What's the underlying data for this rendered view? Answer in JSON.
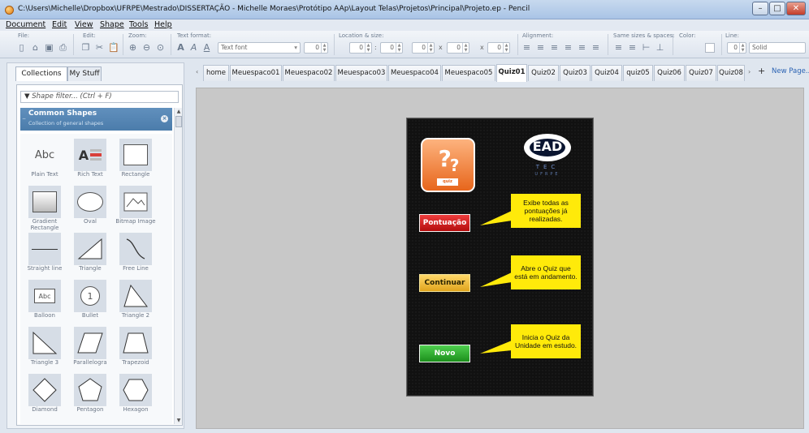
{
  "window": {
    "title": "C:\\Users\\Michelle\\Dropbox\\UFRPE\\Mestrado\\DISSERTAÇÃO - Michelle Moraes\\Protótipo AAp\\Layout Telas\\Projetos\\Principal\\Projeto.ep - Pencil",
    "minimize": "–",
    "maximize": "□",
    "close": "✕"
  },
  "menu": [
    "Document",
    "Edit",
    "View",
    "Shape",
    "Tools",
    "Help"
  ],
  "toolbar": {
    "groups": [
      "File:",
      "Edit:",
      "Zoom:",
      "Text format:",
      "Location & size:",
      "Alignment:",
      "Same sizes & spaces:",
      "Color:",
      "Line:"
    ],
    "font_field": "Text font",
    "font_size": "0",
    "loc_x": "0",
    "loc_y": "0",
    "width": "0",
    "height": "0",
    "line_width": "0",
    "line_style": "Solid",
    "colon": ":",
    "times": "x"
  },
  "left_panel": {
    "tabs": [
      "Collections",
      "My Stuff"
    ],
    "filter_placeholder": "Shape filter... (Ctrl + F)",
    "category_title": "Common Shapes",
    "category_subtitle": "Collection of general shapes",
    "shapes": [
      "Plain Text",
      "Rich Text",
      "Rectangle",
      "Gradient Rectangle",
      "Oval",
      "Bitmap Image",
      "Straight line",
      "Triangle",
      "Free Line",
      "Balloon",
      "Bullet",
      "Triangle 2",
      "Triangle 3",
      "Parallelogra",
      "Trapezoid",
      "Diamond",
      "Pentagon",
      "Hexagon"
    ],
    "thumb_text_abc": "Abc",
    "thumb_text_rich": "A",
    "thumb_text_balloon": "Abc",
    "thumb_text_bullet": "1"
  },
  "tabs": {
    "items": [
      "home",
      "Meuespaco01",
      "Meuespaco02",
      "Meuespaco03",
      "Meuespaco04",
      "Meuespaco05",
      "Quiz01",
      "Quiz02",
      "Quiz03",
      "Quiz04",
      "quiz05",
      "Quiz06",
      "Quiz07",
      "Quiz08"
    ],
    "active": "Quiz01",
    "new_page": "New Page..."
  },
  "mockup": {
    "icon_text": "?",
    "icon_badge": "quiz",
    "logo_main": "EAD",
    "logo_sub": "TEC",
    "logo_uni": "UFRPE",
    "buttons": [
      {
        "label": "Pontuação",
        "color": "#d61f1f"
      },
      {
        "label": "Continuar",
        "color": "#f2c23a"
      },
      {
        "label": "Novo",
        "color": "#2fae2f"
      }
    ],
    "callouts": [
      "Exibe todas as pontuações já realizadas.",
      "Abre o Quiz que está em andamento.",
      "Inicia o Quiz da Unidade em estudo."
    ]
  }
}
